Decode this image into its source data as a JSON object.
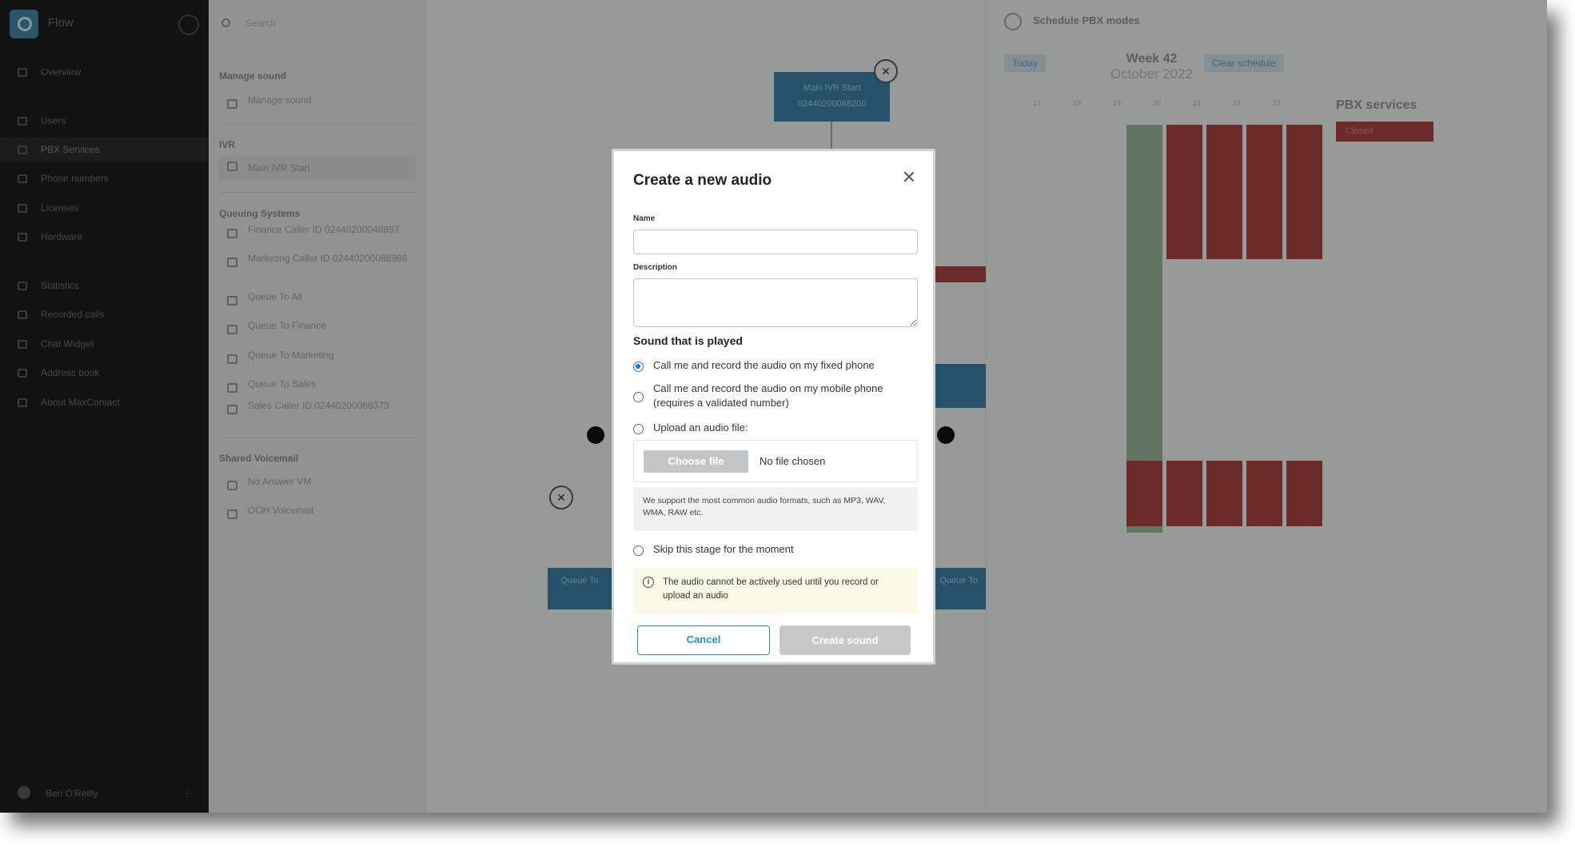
{
  "sidebar": {
    "brand": "Flow",
    "items": [
      {
        "label": "Overview",
        "icon": "home-icon"
      },
      {
        "label": "Users",
        "icon": "users-icon"
      },
      {
        "label": "PBX Services",
        "icon": "pbx-icon"
      },
      {
        "label": "Phone numbers",
        "icon": "phone-icon"
      },
      {
        "label": "Licenses",
        "icon": "license-icon"
      },
      {
        "label": "Hardware",
        "icon": "hardware-icon"
      },
      {
        "label": "Statistics",
        "icon": "chart-icon"
      },
      {
        "label": "Recorded calls",
        "icon": "recording-icon"
      },
      {
        "label": "Chat Widget",
        "icon": "chat-icon"
      },
      {
        "label": "Address book",
        "icon": "book-icon"
      },
      {
        "label": "About MaxContact",
        "icon": "info-icon"
      }
    ],
    "user_name": "Ben O'Reilly"
  },
  "panel": {
    "search_placeholder": "Search",
    "sections": [
      {
        "heading": "Manage sound",
        "items": [
          "Manage sound"
        ]
      },
      {
        "heading": "IVR",
        "items": [
          "Main IVR Start"
        ]
      },
      {
        "heading": "Queuing Systems",
        "items": [
          "Finance Caller ID 02440200048897",
          "Marketing Caller ID 02440200088988",
          "Queue To All",
          "Queue To Finance",
          "Queue To Marketing",
          "Queue To Sales",
          "Sales Caller ID 02440200088373"
        ]
      },
      {
        "heading": "Shared Voicemail",
        "items": [
          "No Answer VM",
          "OOH Voicemail"
        ]
      }
    ]
  },
  "canvas": {
    "node_top_line1": "Main IVR Start",
    "node_top_line2": "02440200088200",
    "node_left": "Queue To",
    "node_right": "Queue To"
  },
  "schedule": {
    "title": "Schedule PBX modes",
    "today_label": "Today",
    "clear_label": "Clear schedule",
    "week": "Week 42",
    "month": "October 2022",
    "days": [
      "17",
      "18",
      "19",
      "20",
      "21",
      "22",
      "23"
    ],
    "legend_title": "PBX services",
    "legend_item": "Closed"
  },
  "modal": {
    "title": "Create a new audio",
    "name_label": "Name",
    "name_value": "",
    "description_label": "Description",
    "description_value": "",
    "section_title": "Sound that is played",
    "options": [
      {
        "label": "Call me and record the audio on my fixed phone",
        "selected": true
      },
      {
        "label": "Call me and record the audio on my mobile phone (requires a validated number)",
        "selected": false
      },
      {
        "label": "Upload an audio file:",
        "selected": false
      },
      {
        "label": "Skip this stage for the moment",
        "selected": false
      }
    ],
    "choose_file_label": "Choose file",
    "no_file_label": "No file chosen",
    "formats_hint": "We support the most common audio formats, such as MP3, WAV, WMA, RAW etc.",
    "notice": "The audio cannot be actively used until you record or upload an audio",
    "cancel_label": "Cancel",
    "create_label": "Create sound",
    "accent_color": "#2a8fc9"
  }
}
